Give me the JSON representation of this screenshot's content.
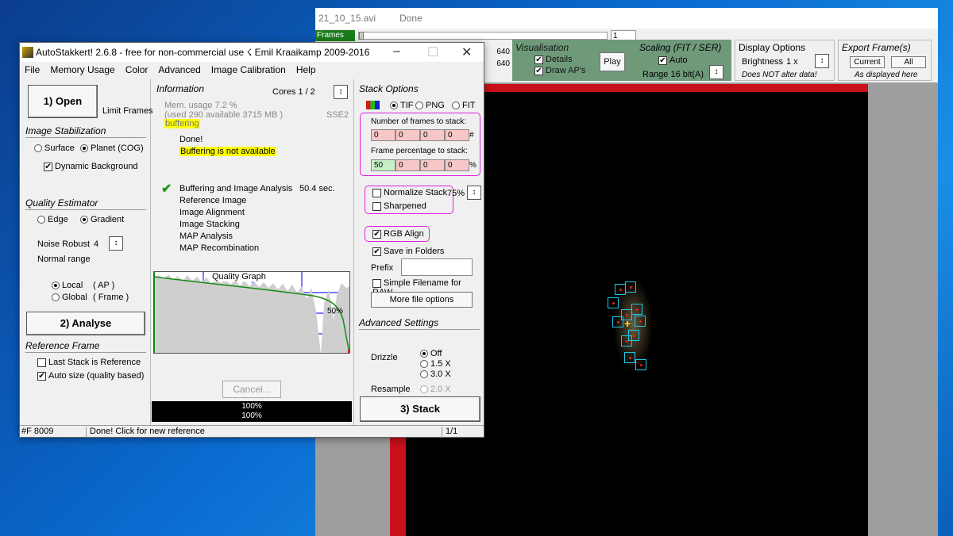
{
  "viewer": {
    "title_file": "21_10_15.avi",
    "title_status": "Done",
    "frames_label": "Frames",
    "frame_number": "1",
    "size_w": "640",
    "size_h": "640",
    "visualisation": {
      "title": "Visualisation",
      "details": "Details",
      "draw_aps": "Draw AP's",
      "play": "Play"
    },
    "scaling": {
      "title": "Scaling (FIT / SER)",
      "auto": "Auto",
      "range": "Range 16 bit(A)"
    },
    "display": {
      "title": "Display Options",
      "brightness": "Brightness",
      "brightness_val": "1 x",
      "note": "Does NOT alter data!"
    },
    "export": {
      "title": "Export Frame(s)",
      "current": "Current",
      "all": "All",
      "note": "As displayed here"
    }
  },
  "main": {
    "title": "AutoStakkert! 2.6.8 - free for non-commercial use ☇ Emil Kraaikamp 2009-2016",
    "menu": [
      "File",
      "Memory Usage",
      "Color",
      "Advanced",
      "Image Calibration",
      "Help"
    ],
    "open_label": "1) Open",
    "limit_frames": "Limit Frames",
    "image_stab": {
      "title": "Image Stabilization",
      "surface": "Surface",
      "planet": "Planet (COG)",
      "dynamic_bg": "Dynamic Background"
    },
    "quality": {
      "title": "Quality Estimator",
      "edge": "Edge",
      "gradient": "Gradient",
      "noise_robust": "Noise Robust",
      "noise_val": "4",
      "normal_range": "Normal range",
      "local": "Local",
      "local_ap": "( AP )",
      "global": "Global",
      "global_frame": "( Frame )"
    },
    "analyse_label": "2) Analyse",
    "reference": {
      "title": "Reference Frame",
      "last_stack": "Last Stack is Reference",
      "auto_size": "Auto size (quality based)"
    },
    "info": {
      "title": "Information",
      "cores": "Cores 1 / 2",
      "mem_usage": "Mem. usage 7.2 %",
      "mem_detail": "(used 290 available 3715 MB )",
      "sse": "SSE2",
      "buffering": "buffering",
      "done": "Done!",
      "buffering_na": "Buffering is not available",
      "steps": [
        "Buffering and Image Analysis",
        "Reference Image",
        "Image Alignment",
        "Image Stacking",
        "MAP Analysis",
        "MAP Recombination"
      ],
      "time": "50.4 sec."
    },
    "graph": {
      "title": "Quality Graph",
      "marker": "50%"
    },
    "cancel_label": "Cancel...",
    "progress_1": "100%",
    "progress_2": "100%",
    "stack": {
      "title": "Stack Options",
      "tif": "TIF",
      "png": "PNG",
      "fit": "FIT",
      "num_frames_label": "Number of frames to stack:",
      "num_frames": [
        "0",
        "0",
        "0",
        "0"
      ],
      "num_unit": "#",
      "pct_label": "Frame percentage to stack:",
      "pct": [
        "50",
        "0",
        "0",
        "0"
      ],
      "pct_unit": "%",
      "normalize": "Normalize Stack",
      "normalize_val": "75%",
      "sharpened": "Sharpened",
      "rgb_align": "RGB Align",
      "save_folders": "Save in Folders",
      "prefix": "Prefix",
      "simple_filename": "Simple Filename for RAW",
      "more_options": "More file options"
    },
    "advanced": {
      "title": "Advanced Settings",
      "drizzle": "Drizzle",
      "off": "Off",
      "d15": "1.5 X",
      "d30": "3.0 X",
      "resample": "Resample",
      "r20": "2.0 X"
    },
    "stack_label": "3) Stack",
    "status": {
      "frames": "#F 8009",
      "message": "Done! Click for new reference",
      "page": "1/1"
    }
  },
  "colors": {
    "accent_green": "#6f9a7a",
    "highlight_yellow": "#ffff00",
    "annotation_magenta": "#e020e0",
    "ap_cyan": "#1ec8e8"
  }
}
